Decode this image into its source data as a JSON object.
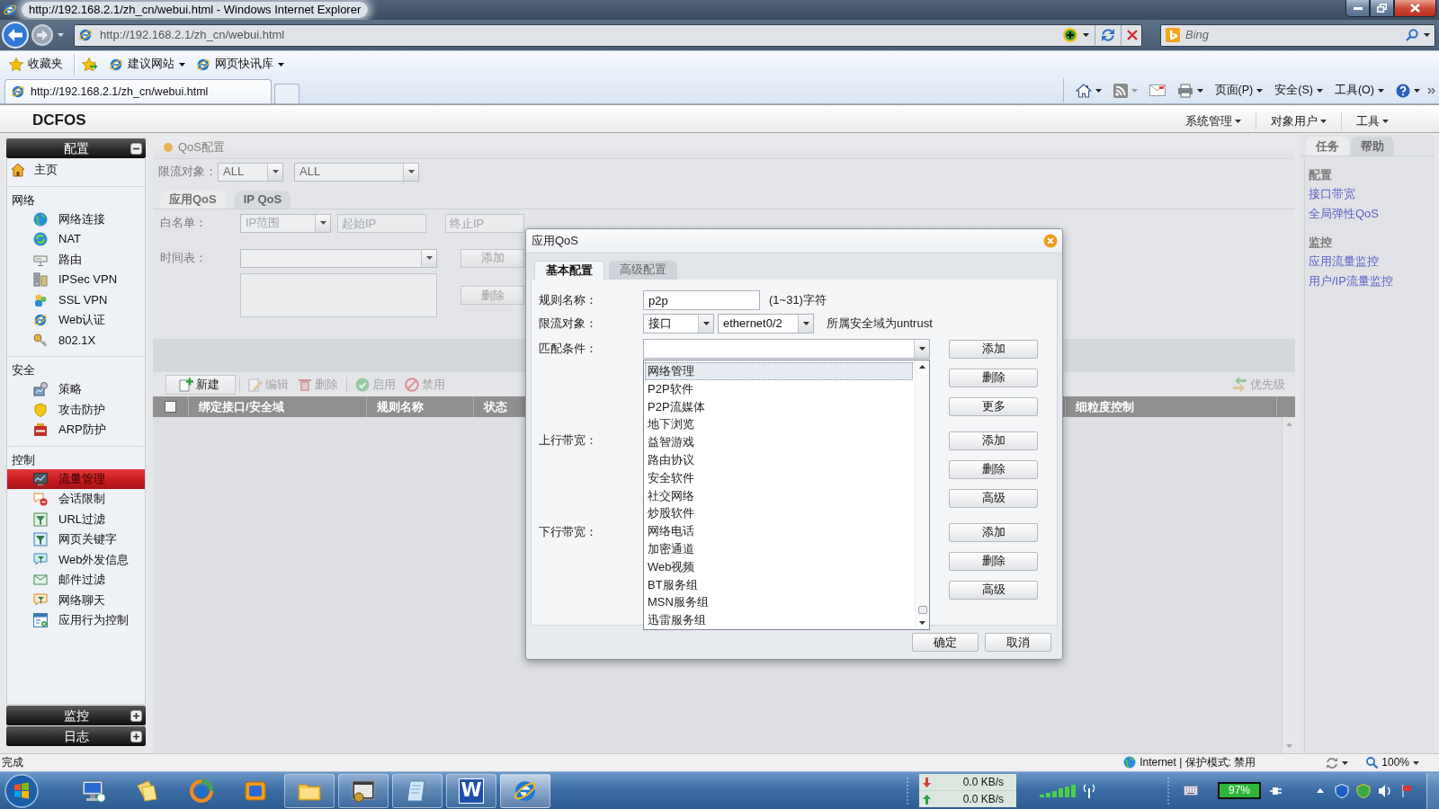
{
  "browser": {
    "title": "http://192.168.2.1/zh_cn/webui.html - Windows Internet Explorer",
    "address": "http://192.168.2.1/zh_cn/webui.html",
    "search": {
      "placeholder": "Bing"
    },
    "favorites": [
      {
        "kind": "favorites",
        "label": "收藏夹"
      },
      {
        "kind": "menu",
        "label": "建议网站"
      },
      {
        "kind": "menu",
        "label": "网页快讯库"
      }
    ],
    "tabs": [
      {
        "label": "http://192.168.2.1/zh_cn/webui.html",
        "selected": true
      }
    ],
    "commands": [
      "页面(P)",
      "安全(S)",
      "工具(O)"
    ]
  },
  "app": {
    "logo": "DCFOS",
    "menus": [
      "系统管理",
      "对象用户",
      "工具"
    ]
  },
  "sidebar": {
    "panels": [
      {
        "title": "配置",
        "expanded": true,
        "groups": [
          {
            "items": [
              {
                "label": "主页",
                "selected": false
              }
            ]
          },
          {
            "heading": "网络",
            "items": [
              {
                "label": "网络连接",
                "selected": false
              },
              {
                "label": "NAT",
                "selected": false
              },
              {
                "label": "路由",
                "selected": false
              },
              {
                "label": "IPSec VPN",
                "selected": false
              },
              {
                "label": "SSL VPN",
                "selected": false
              },
              {
                "label": "Web认证",
                "selected": false
              },
              {
                "label": "802.1X",
                "selected": false
              }
            ]
          },
          {
            "heading": "安全",
            "items": [
              {
                "label": "策略",
                "selected": false
              },
              {
                "label": "攻击防护",
                "selected": false
              },
              {
                "label": "ARP防护",
                "selected": false
              }
            ]
          },
          {
            "heading": "控制",
            "items": [
              {
                "label": "流量管理",
                "selected": true
              },
              {
                "label": "会话限制",
                "selected": false
              },
              {
                "label": "URL过滤",
                "selected": false
              },
              {
                "label": "网页关键字",
                "selected": false
              },
              {
                "label": "Web外发信息",
                "selected": false
              },
              {
                "label": "邮件过滤",
                "selected": false
              },
              {
                "label": "网络聊天",
                "selected": false
              },
              {
                "label": "应用行为控制",
                "selected": false
              }
            ]
          }
        ]
      },
      {
        "title": "监控",
        "expanded": false
      },
      {
        "title": "日志",
        "expanded": false
      }
    ]
  },
  "qos": {
    "title": "QoS配置",
    "filter": {
      "label": "限流对象：",
      "selects": [
        "ALL",
        "ALL"
      ]
    },
    "tabs": [
      {
        "label": "应用QoS",
        "selected": true
      },
      {
        "label": "IP QoS",
        "selected": false
      }
    ],
    "whitelist": {
      "label": "白名单：",
      "disabled": true,
      "select": "IP范围",
      "start_placeholder": "起始IP",
      "end_placeholder": "终止IP"
    },
    "schedule": {
      "label": "时间表：",
      "disabled": true,
      "buttons": [
        "添加",
        "删除"
      ]
    },
    "toolbar": [
      {
        "label": "新建",
        "disabled": false
      },
      {
        "label": "编辑",
        "disabled": true
      },
      {
        "label": "删除",
        "disabled": true
      },
      {
        "label": "启用",
        "disabled": true
      },
      {
        "label": "禁用",
        "disabled": true
      }
    ],
    "priority": {
      "label": "优先级",
      "disabled": true
    },
    "table": {
      "select_all": {
        "checked": false
      },
      "columns": [
        "绑定接口/安全域",
        "规则名称",
        "状态",
        "细粒度控制"
      ]
    }
  },
  "dialog": {
    "title": "应用QoS",
    "tabs": [
      {
        "label": "基本配置",
        "selected": true
      },
      {
        "label": "高级配置",
        "selected": false
      }
    ],
    "fields": [
      {
        "kind": "text",
        "label": "规则名称：",
        "value": "p2p",
        "hint": "(1~31)字符"
      },
      {
        "kind": "selects",
        "label": "限流对象：",
        "values": [
          "接口",
          "ethernet0/2"
        ],
        "note": "所属安全域为untrust"
      },
      {
        "kind": "combo",
        "label": "匹配条件：",
        "expanded": true,
        "options": [
          {
            "label": "网络管理",
            "selected": true
          },
          {
            "label": "P2P软件",
            "selected": false
          },
          {
            "label": "P2P流媒体",
            "selected": false
          },
          {
            "label": "地下浏览",
            "selected": false
          },
          {
            "label": "益智游戏",
            "selected": false
          },
          {
            "label": "路由协议",
            "selected": false
          },
          {
            "label": "安全软件",
            "selected": false
          },
          {
            "label": "社交网络",
            "selected": false
          },
          {
            "label": "炒股软件",
            "selected": false
          },
          {
            "label": "网络电话",
            "selected": false
          },
          {
            "label": "加密通道",
            "selected": false
          },
          {
            "label": "Web视频",
            "selected": false
          },
          {
            "label": "BT服务组",
            "selected": false
          },
          {
            "label": "MSN服务组",
            "selected": false
          },
          {
            "label": "迅雷服务组",
            "selected": false
          }
        ],
        "buttons": [
          "添加",
          "删除",
          "更多"
        ]
      },
      {
        "kind": "buttons",
        "label": "上行带宽：",
        "buttons": [
          "添加",
          "删除",
          "高级"
        ]
      },
      {
        "kind": "buttons",
        "label": "下行带宽：",
        "buttons": [
          "添加",
          "删除",
          "高级"
        ]
      }
    ],
    "footer": [
      "确定",
      "取消"
    ]
  },
  "tasks": {
    "tabs": [
      {
        "label": "任务",
        "selected": true
      },
      {
        "label": "帮助",
        "selected": false
      }
    ],
    "sections": [
      {
        "heading": "配置",
        "links": [
          "接口带宽",
          "全局弹性QoS"
        ]
      },
      {
        "heading": "监控",
        "links": [
          "应用流量监控",
          "用户/IP流量监控"
        ]
      }
    ]
  },
  "status_bar": {
    "text": "完成",
    "zone": "Internet | 保护模式: 禁用",
    "zoom": "100%"
  },
  "taskbar": {
    "apps": [
      {
        "open": false,
        "selected": false
      },
      {
        "open": false,
        "selected": false
      },
      {
        "open": false,
        "selected": false
      },
      {
        "open": false,
        "selected": false
      },
      {
        "open": true,
        "selected": false
      },
      {
        "open": true,
        "selected": false
      },
      {
        "open": true,
        "selected": false
      },
      {
        "open": true,
        "selected": false,
        "label": "W"
      },
      {
        "open": true,
        "selected": true
      }
    ],
    "net_down": "0.0 KB/s",
    "net_up": "0.0 KB/s",
    "battery": "97%"
  }
}
